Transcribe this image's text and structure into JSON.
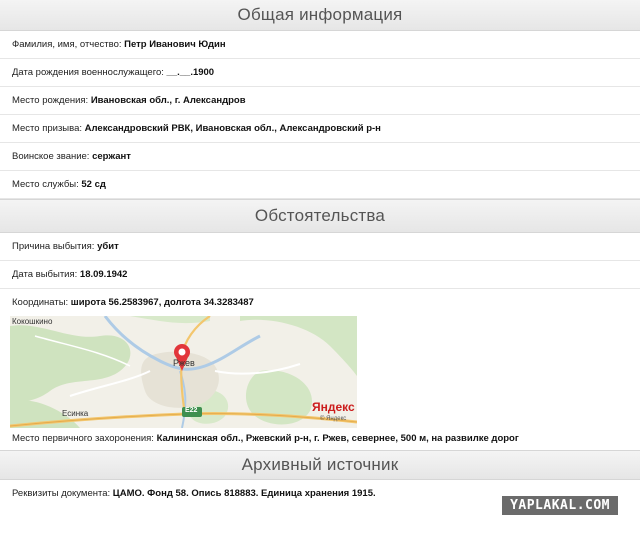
{
  "general": {
    "title": "Общая информация",
    "rows": [
      {
        "label": "Фамилия, имя, отчество: ",
        "value": "Петр Иванович Юдин"
      },
      {
        "label": "Дата рождения военнослужащего: ",
        "value": "__.__.1900"
      },
      {
        "label": "Место рождения: ",
        "value": "Ивановская обл., г. Александров"
      },
      {
        "label": "Место призыва: ",
        "value": "Александровский РВК, Ивановская обл., Александровский р-н"
      },
      {
        "label": "Воинское звание: ",
        "value": "сержант"
      },
      {
        "label": "Место службы: ",
        "value": "52 сд"
      }
    ]
  },
  "circumstances": {
    "title": "Обстоятельства",
    "rows": [
      {
        "label": "Причина выбытия: ",
        "value": "убит"
      },
      {
        "label": "Дата выбытия: ",
        "value": "18.09.1942"
      },
      {
        "label": "Координаты: ",
        "value": "широта 56.2583967, долгота 34.3283487"
      }
    ],
    "map": {
      "labels": {
        "kokoshkino": "Кокошкино",
        "rzhev": "Ржев",
        "esinka": "Есинка",
        "road": "E22"
      },
      "logo": "Яндекс",
      "logo_sub": "© Яндекс"
    },
    "burial": {
      "label": "Место первичного захоронения: ",
      "value": "Калининская обл., Ржевский р-н, г. Ржев, севернее, 500 м, на развилке дорог"
    }
  },
  "archive": {
    "title": "Архивный источник",
    "rows": [
      {
        "label": "Реквизиты документа: ",
        "value": "ЦАМО. Фонд 58. Опись 818883. Единица хранения 1915."
      }
    ]
  },
  "watermark": "YAPLAKAL.COM"
}
